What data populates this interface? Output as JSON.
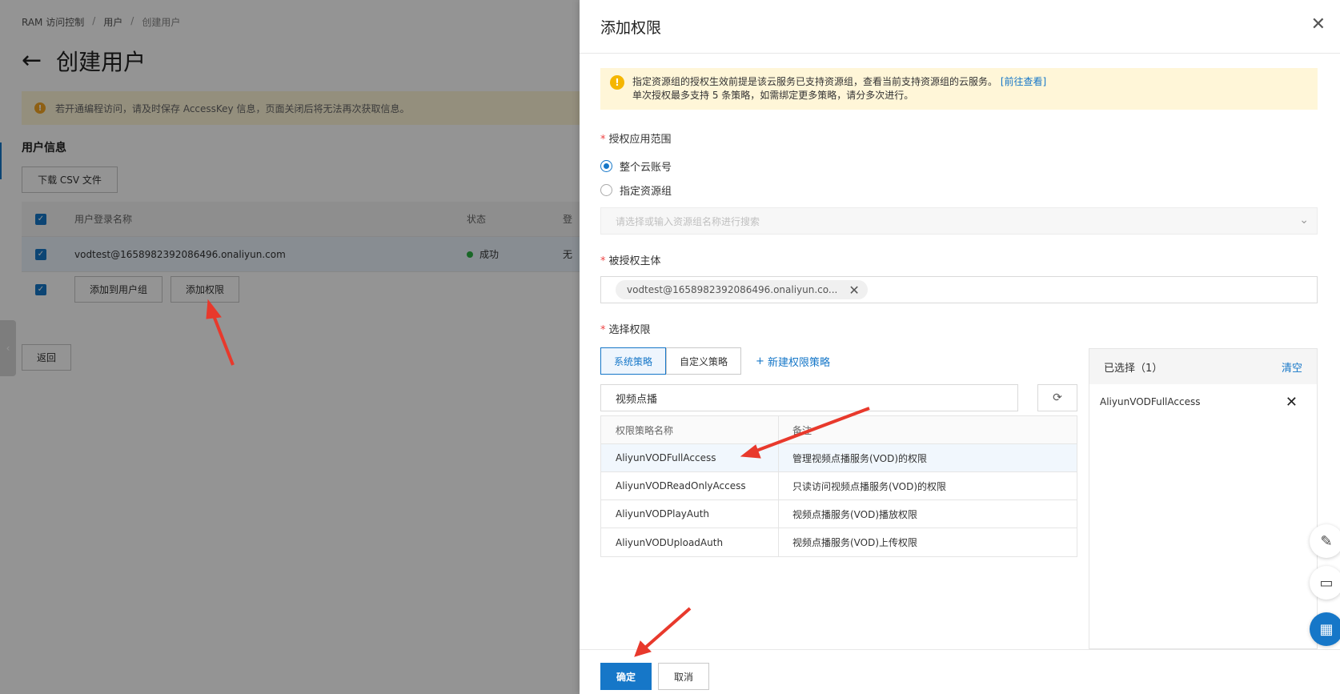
{
  "breadcrumb": {
    "root": "RAM 访问控制",
    "sep": "/",
    "users": "用户",
    "current": "创建用户"
  },
  "page": {
    "back_glyph": "←",
    "title": "创建用户",
    "warning": "若开通编程访问，请及时保存 AccessKey 信息，页面关闭后将无法再次获取信息。",
    "section_title": "用户信息",
    "download_csv": "下载 CSV 文件",
    "table": {
      "col_name": "用户登录名称",
      "col_status": "状态",
      "col_login": "登",
      "rows": [
        {
          "name": "vodtest@1658982392086496.onaliyun.com",
          "status": "成功",
          "login": "无"
        }
      ]
    },
    "add_to_group": "添加到用户组",
    "add_permission": "添加权限",
    "back_button": "返回"
  },
  "drawer": {
    "title": "添加权限",
    "close_glyph": "✕",
    "info_line1": "指定资源组的授权生效前提是该云服务已支持资源组，查看当前支持资源组的云服务。",
    "info_link": "[前往查看]",
    "info_line2": "单次授权最多支持 5 条策略，如需绑定更多策略，请分多次进行。",
    "scope_label": "授权应用范围",
    "scope_options": [
      "整个云账号",
      "指定资源组"
    ],
    "scope_selected": "整个云账号",
    "resource_group_placeholder": "请选择或输入资源组名称进行搜索",
    "principal_label": "被授权主体",
    "principal_tag": "vodtest@1658982392086496.onaliyun.co...",
    "permission_label": "选择权限",
    "tabs": [
      "系统策略",
      "自定义策略"
    ],
    "active_tab": "系统策略",
    "new_policy": "新建权限策略",
    "search_value": "视频点播",
    "policy_table": {
      "col_name": "权限策略名称",
      "col_note": "备注",
      "rows": [
        {
          "name": "AliyunVODFullAccess",
          "note": "管理视频点播服务(VOD)的权限"
        },
        {
          "name": "AliyunVODReadOnlyAccess",
          "note": "只读访问视频点播服务(VOD)的权限"
        },
        {
          "name": "AliyunVODPlayAuth",
          "note": "视频点播服务(VOD)播放权限"
        },
        {
          "name": "AliyunVODUploadAuth",
          "note": "视频点播服务(VOD)上传权限"
        }
      ]
    },
    "selected_title": "已选择（1）",
    "clear": "清空",
    "selected_items": [
      "AliyunVODFullAccess"
    ],
    "ok": "确定",
    "cancel": "取消"
  },
  "colors": {
    "accent": "#1677c8",
    "warning_bg": "#fff6d8",
    "arrow": "#e8392c",
    "success": "#2bb244"
  },
  "icons": [
    "arrow-left-icon",
    "close-icon",
    "warning-icon",
    "plus-icon",
    "refresh-icon",
    "chevron-down-icon",
    "edit-icon",
    "chat-icon",
    "apps-icon"
  ]
}
